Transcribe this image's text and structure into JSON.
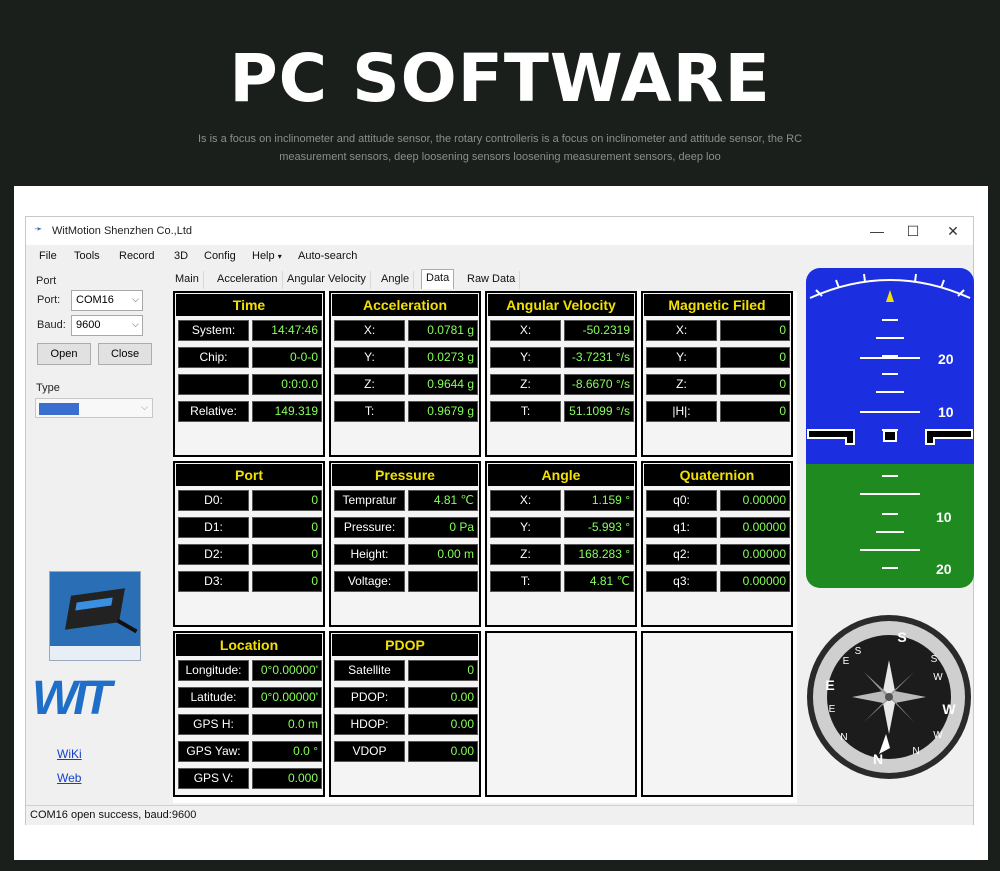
{
  "banner": {
    "title": "PC SOFTWARE",
    "subtitle_line1": "Is is a focus on inclinometer and attitude sensor, the  rotary controlleris is a focus on inclinometer and attitude sensor, the RC",
    "subtitle_line2": "measurement sensors, deep loosening sensors loosening measurement sensors, deep loo"
  },
  "window": {
    "title": "WitMotion Shenzhen Co.,Ltd",
    "minimize": "—",
    "maximize": "☐",
    "close": "✕"
  },
  "menu": {
    "file": "File",
    "tools": "Tools",
    "record": "Record",
    "threed": "3D",
    "config": "Config",
    "help": "Help",
    "help_arrow": "▾",
    "autosearch": "Auto-search"
  },
  "port_group": {
    "label": "Port",
    "port_label": "Port:",
    "port_value": "COM16",
    "baud_label": "Baud:",
    "baud_value": "9600",
    "open": "Open",
    "close": "Close"
  },
  "type_group": {
    "label": "Type"
  },
  "links": {
    "wiki": "WiKi",
    "web": "Web"
  },
  "logo_text": "WIT",
  "tabs": [
    "Main",
    "Acceleration",
    "Angular Velocity",
    "Angle",
    "Data",
    "Raw Data"
  ],
  "active_tab": "Data",
  "panels": {
    "time": {
      "title": "Time",
      "rows": [
        {
          "label": "System:",
          "value": "14:47:46"
        },
        {
          "label": "Chip:",
          "value": "0-0-0"
        },
        {
          "label": "",
          "value": "0:0:0.0"
        },
        {
          "label": "Relative:",
          "value": "149.319"
        }
      ]
    },
    "acceleration": {
      "title": "Acceleration",
      "rows": [
        {
          "label": "X:",
          "value": "0.0781 g"
        },
        {
          "label": "Y:",
          "value": "0.0273 g"
        },
        {
          "label": "Z:",
          "value": "0.9644 g"
        },
        {
          "label": "T:",
          "value": "0.9679 g"
        }
      ]
    },
    "angular_velocity": {
      "title": "Angular Velocity",
      "rows": [
        {
          "label": "X:",
          "value": "-50.2319"
        },
        {
          "label": "Y:",
          "value": "-3.7231 °/s"
        },
        {
          "label": "Z:",
          "value": "-8.6670 °/s"
        },
        {
          "label": "T:",
          "value": "51.1099 °/s"
        }
      ]
    },
    "magnetic": {
      "title": "Magnetic Filed",
      "rows": [
        {
          "label": "X:",
          "value": "0"
        },
        {
          "label": "Y:",
          "value": "0"
        },
        {
          "label": "Z:",
          "value": "0"
        },
        {
          "label": "|H|:",
          "value": "0"
        }
      ]
    },
    "port": {
      "title": "Port",
      "rows": [
        {
          "label": "D0:",
          "value": "0"
        },
        {
          "label": "D1:",
          "value": "0"
        },
        {
          "label": "D2:",
          "value": "0"
        },
        {
          "label": "D3:",
          "value": "0"
        }
      ]
    },
    "pressure": {
      "title": "Pressure",
      "rows": [
        {
          "label": "Tempratur",
          "value": "4.81 ℃"
        },
        {
          "label": "Pressure:",
          "value": "0 Pa"
        },
        {
          "label": "Height:",
          "value": "0.00 m"
        },
        {
          "label": "Voltage:",
          "value": ""
        }
      ]
    },
    "angle": {
      "title": "Angle",
      "rows": [
        {
          "label": "X:",
          "value": "1.159 °"
        },
        {
          "label": "Y:",
          "value": "-5.993 °"
        },
        {
          "label": "Z:",
          "value": "168.283 °"
        },
        {
          "label": "T:",
          "value": "4.81 ℃"
        }
      ]
    },
    "quaternion": {
      "title": "Quaternion",
      "rows": [
        {
          "label": "q0:",
          "value": "0.00000"
        },
        {
          "label": "q1:",
          "value": "0.00000"
        },
        {
          "label": "q2:",
          "value": "0.00000"
        },
        {
          "label": "q3:",
          "value": "0.00000"
        }
      ]
    },
    "location": {
      "title": "Location",
      "rows": [
        {
          "label": "Longitude:",
          "value": "0°0.00000'"
        },
        {
          "label": "Latitude:",
          "value": "0°0.00000'"
        },
        {
          "label": "GPS H:",
          "value": "0.0 m"
        },
        {
          "label": "GPS Yaw:",
          "value": "0.0 °"
        },
        {
          "label": "GPS V:",
          "value": "0.000"
        }
      ]
    },
    "pdop": {
      "title": "PDOP",
      "rows": [
        {
          "label": "Satellite",
          "value": "0"
        },
        {
          "label": "PDOP:",
          "value": "0.00"
        },
        {
          "label": "HDOP:",
          "value": "0.00"
        },
        {
          "label": "VDOP",
          "value": "0.00"
        }
      ]
    }
  },
  "attitude": {
    "labels": [
      "20",
      "10",
      "10",
      "20"
    ],
    "sky_color": "#1c2fe0",
    "ground_color": "#1f8a1f"
  },
  "compass": {
    "letters": [
      "S",
      "W",
      "N",
      "E"
    ],
    "secondary": [
      "S",
      "S",
      "W",
      "W",
      "N",
      "N",
      "E",
      "E"
    ]
  },
  "status": {
    "text": "COM16 open success, baud:9600"
  }
}
